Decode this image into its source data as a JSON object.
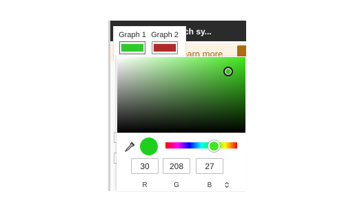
{
  "background": {
    "search_text": "ch sy...",
    "banner_text": "earn more"
  },
  "graph_tabs": [
    {
      "label": "Graph 1",
      "color": "#2ec92e",
      "selected": true
    },
    {
      "label": "Graph 2",
      "color": "#b02a2a",
      "selected": false
    }
  ],
  "picker": {
    "hue_color": "#3fe81c",
    "current_color": "#1ed01b",
    "hue_position": 0.67,
    "channels": [
      {
        "label": "R",
        "value": "30"
      },
      {
        "label": "G",
        "value": "208"
      },
      {
        "label": "B",
        "value": "27"
      }
    ],
    "icons": {
      "eyedropper": "eyedropper-icon",
      "mode_toggle": "chevron-up-down-icon"
    }
  }
}
